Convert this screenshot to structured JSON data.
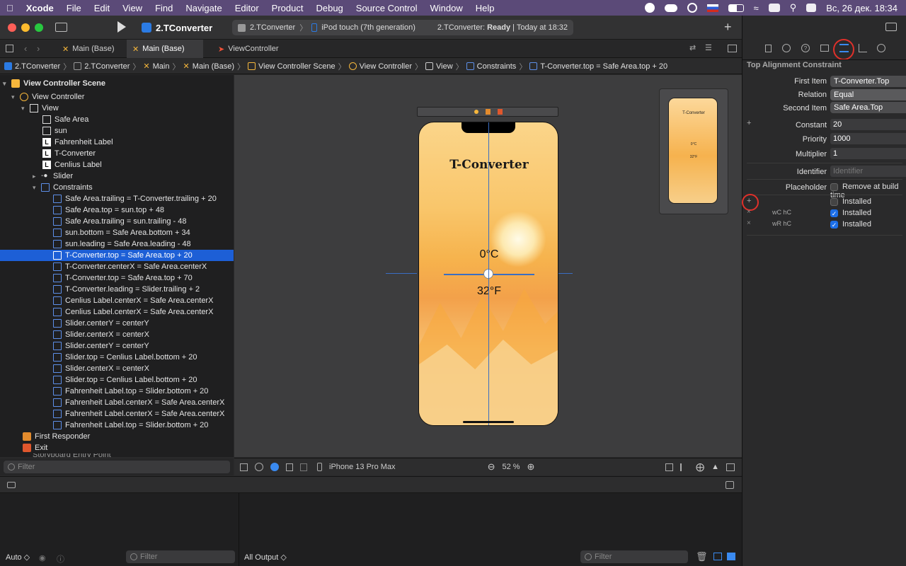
{
  "menubar": {
    "app": "Xcode",
    "items": [
      "File",
      "Edit",
      "View",
      "Find",
      "Navigate",
      "Editor",
      "Product",
      "Debug",
      "Source Control",
      "Window",
      "Help"
    ],
    "clock": "Вс, 26 дек.  18:34"
  },
  "toolbar": {
    "project": "2.TConverter",
    "scheme": "2.TConverter",
    "device": "iPod touch (7th generation)",
    "status_name": "2.TConverter:",
    "status_state": "Ready",
    "status_time": "| Today at 18:32"
  },
  "tabs": [
    {
      "label": "Main (Base)"
    },
    {
      "label": "Main (Base)"
    },
    {
      "label": "ViewController"
    }
  ],
  "jumpbar": [
    "2.TConverter",
    "2.TConverter",
    "Main",
    "Main (Base)",
    "View Controller Scene",
    "View Controller",
    "View",
    "Constraints",
    "T-Converter.top = Safe Area.top + 20"
  ],
  "outline": {
    "scene": "View Controller Scene",
    "vc": "View Controller",
    "view": "View",
    "children": [
      {
        "label": "Safe Area",
        "icon": "safe-area"
      },
      {
        "label": "sun",
        "icon": "image"
      },
      {
        "label": "Fahrenheit Label",
        "icon": "label"
      },
      {
        "label": "T-Converter",
        "icon": "label"
      },
      {
        "label": "Cenlius Label",
        "icon": "label"
      },
      {
        "label": "Slider",
        "icon": "slider"
      },
      {
        "label": "Constraints",
        "icon": "constraints"
      }
    ],
    "constraints": [
      "Safe Area.trailing = T-Converter.trailing + 20",
      "Safe Area.top = sun.top + 48",
      "Safe Area.trailing = sun.trailing - 48",
      "sun.bottom = Safe Area.bottom + 34",
      "sun.leading = Safe Area.leading - 48",
      "T-Converter.top = Safe Area.top + 20",
      "T-Converter.centerX = Safe Area.centerX",
      "T-Converter.top = Safe Area.top + 70",
      "T-Converter.leading = Slider.trailing + 2",
      "Cenlius Label.centerX = Safe Area.centerX",
      "Cenlius Label.centerX = Safe Area.centerX",
      "Slider.centerY = centerY",
      "Slider.centerX = centerX",
      "Slider.centerY = centerY",
      "Slider.top = Cenlius Label.bottom + 20",
      "Slider.centerX = centerX",
      "Slider.top = Cenlius Label.bottom + 20",
      "Fahrenheit Label.top = Slider.bottom + 20",
      "Fahrenheit Label.centerX = Safe Area.centerX",
      "Fahrenheit Label.centerX = Safe Area.centerX",
      "Fahrenheit Label.top = Slider.bottom + 20"
    ],
    "selected_index": 5,
    "first_responder": "First Responder",
    "exit": "Exit",
    "partial": "Storyboard Entry Point",
    "filter_placeholder": "Filter"
  },
  "canvas": {
    "title": "T-Converter",
    "celsius": "0°C",
    "fahrenheit": "32°F",
    "mini_title": "T-Converter",
    "mini_celsius": "0°C",
    "mini_fahrenheit": "32°F"
  },
  "canvasbar": {
    "device": "iPhone 13 Pro Max",
    "zoom": "52 %"
  },
  "debug": {
    "auto": "Auto ◇",
    "filter_placeholder": "Filter",
    "output": "All Output ◇",
    "filter2_placeholder": "Filter"
  },
  "inspector": {
    "title": "Top Alignment Constraint",
    "first_item_label": "First Item",
    "first_item": "T-Converter.Top",
    "relation_label": "Relation",
    "relation": "Equal",
    "second_item_label": "Second Item",
    "second_item": "Safe Area.Top",
    "constant_label": "Constant",
    "constant": "20",
    "priority_label": "Priority",
    "priority": "1000",
    "multiplier_label": "Multiplier",
    "multiplier": "1",
    "identifier_label": "Identifier",
    "identifier_placeholder": "Identifier",
    "placeholder_label": "Placeholder",
    "remove_label": "Remove at build time",
    "installed_label": "Installed",
    "variations": [
      {
        "traits": "wC hC",
        "label": "Installed",
        "checked": true
      },
      {
        "traits": "wR hC",
        "label": "Installed",
        "checked": true
      }
    ]
  },
  "colors": {
    "accent": "#1d6fe8",
    "selection": "#1d5fd6",
    "annotation": "#e0302a",
    "menubar": "#5b4a78"
  }
}
